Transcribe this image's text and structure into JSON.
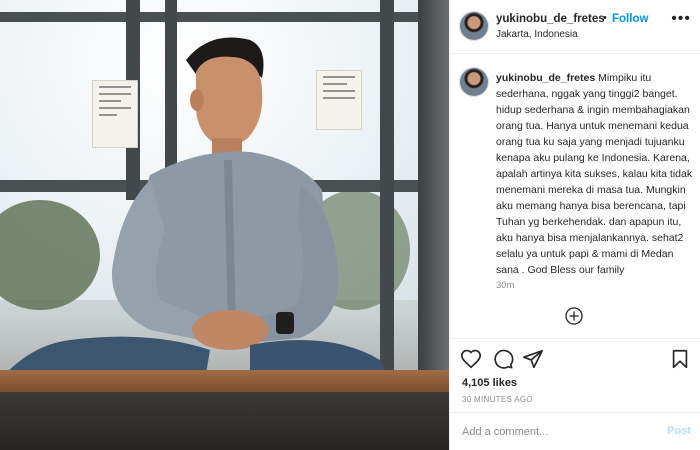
{
  "post": {
    "username": "yukinobu_de_fretes",
    "separator": "•",
    "follow_label": "Follow",
    "location": "Jakarta, Indonesia",
    "more_icon": "•••",
    "caption": "Mimpiku itu sederhana, nggak yang tinggi2 banget. hidup sederhana & ingin membahagiakan orang tua. Hanya untuk menemani kedua orang tua ku saja yang menjadi tujuanku kenapa aku pulang ke Indonesia. Karena, apalah artinya kita sukses, kalau kita tidak menemani mereka di masa tua. Mungkin aku memang hanya bisa berencana, tapi Tuhan yg berkehendak. dan apapun itu, aku hanya bisa menjalankannya. sehat2 selalu ya untuk papi & mami di Medan sana . God Bless our family",
    "caption_time": "30m",
    "likes": "4,105 likes",
    "posted_ago": "30 MINUTES AGO",
    "comment_placeholder": "Add a comment...",
    "post_label": "Post"
  },
  "photo_signs": [
    "テロ対策 特別警戒実施中",
    "テロ対策 特別警戒実施中"
  ],
  "icons": {
    "like": "heart-icon",
    "comment": "comment-icon",
    "share": "share-icon",
    "save": "bookmark-icon",
    "load_more": "plus-circle-icon"
  },
  "colors": {
    "follow_blue": "#0095f6",
    "post_disabled": "#b2dffc",
    "muted": "#8e8e8e",
    "text": "#262626"
  }
}
